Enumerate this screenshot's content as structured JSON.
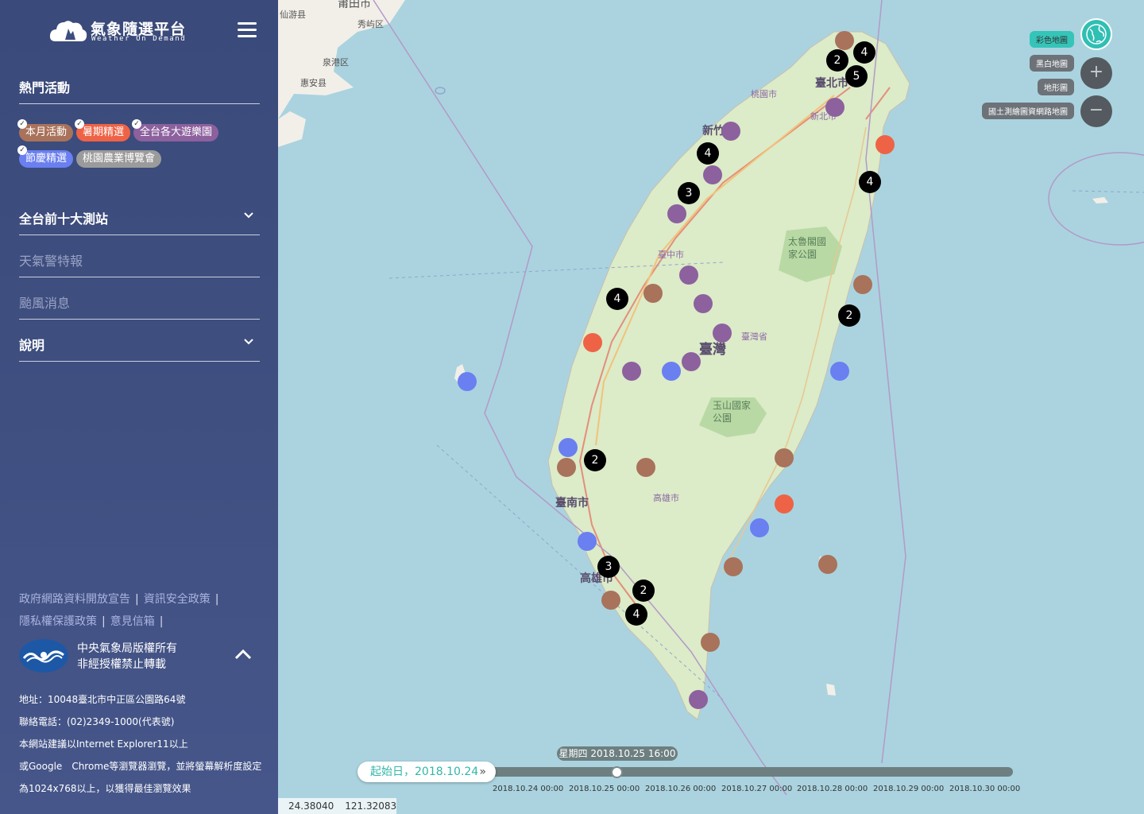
{
  "app": {
    "title": "氣象隨選平台",
    "subtitle": "Weather On Demand"
  },
  "sidebar": {
    "hot_title": "熱門活動",
    "tags": [
      {
        "label": "本月活動",
        "color": "#a9725b",
        "checked": true
      },
      {
        "label": "暑期精選",
        "color": "#ee6346",
        "checked": true
      },
      {
        "label": "全台各大遊樂園",
        "color": "#8c619e",
        "checked": true
      },
      {
        "label": "節慶精選",
        "color": "#6a7ff0",
        "checked": true
      },
      {
        "label": "桃園農業博覽會",
        "color": "#9b9b9b",
        "checked": false
      }
    ],
    "menu": [
      {
        "label": "全台前十大測站",
        "expandable": true
      },
      {
        "label": "天氣警特報",
        "expandable": false
      },
      {
        "label": "颱風消息",
        "expandable": false
      },
      {
        "label": "說明",
        "expandable": true
      }
    ],
    "footer_links": [
      "政府網路資料開放宣告",
      "資訊安全政策",
      "隱私權保護政策",
      "意見信箱"
    ],
    "copyright_1": "中央氣象局版權所有",
    "copyright_2": "非經授權禁止轉載",
    "address": "地址：10048臺北市中正區公園路64號",
    "phone": "聯絡電話：(02)2349-1000(代表號)",
    "note_1": "本網站建議以Internet Explorer11以上",
    "note_2": "或Google　Chrome等瀏覽器瀏覽，並將螢幕解析度設定",
    "note_3": "為1024x768以上，以獲得最佳瀏覽效果"
  },
  "map": {
    "places": [
      "莆田市",
      "秀屿区",
      "仙游县",
      "泉港区",
      "惠安县",
      "臺北市",
      "桃園市",
      "新北市",
      "新竹",
      "臺中市",
      "太魯閣國家公園",
      "臺灣省",
      "臺灣",
      "玉山國家公園",
      "臺南市",
      "高雄市",
      "高雄市"
    ],
    "layers": [
      {
        "label": "彩色地圖",
        "active": true
      },
      {
        "label": "黑白地圖",
        "active": false
      },
      {
        "label": "地形圖",
        "active": false
      },
      {
        "label": "國土測繪圖資網路地圖",
        "active": false
      }
    ],
    "zoom_in": "+",
    "zoom_out": "−",
    "clusters": [
      "4",
      "2",
      "5",
      "4",
      "4",
      "3",
      "4",
      "2",
      "2",
      "3",
      "2",
      "4"
    ],
    "coords": {
      "lat": "24.38040",
      "lng": "121.32083"
    }
  },
  "timeline": {
    "start_label": "起始日，2018.10.24",
    "current": "星期四 2018.10.25 16:00",
    "ticks": [
      "2018.10.24 00:00",
      "2018.10.25 00:00",
      "2018.10.26 00:00",
      "2018.10.27 00:00",
      "2018.10.28 00:00",
      "2018.10.29 00:00",
      "2018.10.30 00:00"
    ]
  }
}
